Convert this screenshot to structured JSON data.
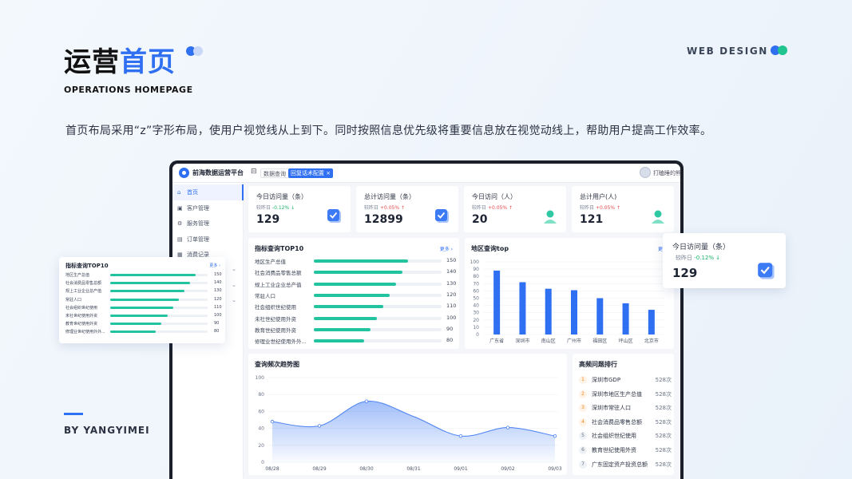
{
  "header": {
    "title_part1": "运营",
    "title_part2": "首页",
    "subtitle": "OPERATIONS HOMEPAGE",
    "web_design": "WEB DESIGN",
    "description": "首页布局采用“z”字形布局，使用户视觉线从上到下。同时按照信息优先级将重要信息放在视觉动线上，帮助用户提高工作效率。",
    "byline": "BY YANGYIMEI"
  },
  "colors": {
    "accent": "#2f6ff2",
    "bar": "#22c4a0",
    "up": "#e84b4b",
    "down": "#18b26b",
    "green_dot": "#1fc48f"
  },
  "app": {
    "title": "前海数据运营平台",
    "tabs": [
      "数据查询",
      "回复话术配置"
    ],
    "tab_close": "×",
    "user_name": "打瞌睡的熊",
    "sidebar": [
      {
        "label": "首页",
        "icon": "home-icon"
      },
      {
        "label": "客户管理",
        "icon": "customer-icon"
      },
      {
        "label": "服务管理",
        "icon": "service-icon"
      },
      {
        "label": "订单管理",
        "icon": "order-icon"
      },
      {
        "label": "消费记录",
        "icon": "record-icon"
      }
    ],
    "stats": [
      {
        "title": "今日访问量（条）",
        "cmp_label": "较昨日",
        "cmp_value": "-0.12%",
        "trend": "down",
        "value": "129",
        "icon": "checkbox-icon"
      },
      {
        "title": "总计访问量（条）",
        "cmp_label": "较昨日",
        "cmp_value": "+0.05%",
        "trend": "up",
        "value": "12899",
        "icon": "checkbox-icon"
      },
      {
        "title": "今日访问（人）",
        "cmp_label": "较昨日",
        "cmp_value": "+0.05%",
        "trend": "up",
        "value": "20",
        "icon": "user-icon"
      },
      {
        "title": "总计用户(人)",
        "cmp_label": "较昨日",
        "cmp_value": "+0.05%",
        "trend": "up",
        "value": "121",
        "icon": "user-icon"
      }
    ],
    "top10": {
      "title": "指标查询TOP10",
      "more": "更多 ›",
      "max": 150,
      "rows": [
        {
          "label": "地区生产总值",
          "value": 150
        },
        {
          "label": "社会消费品零售总额",
          "value": 140
        },
        {
          "label": "规上工业企业总产值",
          "value": 130
        },
        {
          "label": "常驻人口",
          "value": 120
        },
        {
          "label": "社会组织世纪使用",
          "value": 110
        },
        {
          "label": "未社世纪使用外资",
          "value": 100
        },
        {
          "label": "教育世纪使用外资",
          "value": 90
        },
        {
          "label": "修理业世纪使用外外...",
          "value": 80
        }
      ]
    },
    "region": {
      "title": "地区查询top",
      "more": "更多"
    },
    "trend": {
      "title": "查询频次趋势图"
    },
    "ranking": {
      "title": "高频问题排行",
      "items": [
        {
          "no": "1",
          "label": "深圳市GDP",
          "count": "528次"
        },
        {
          "no": "2",
          "label": "深圳市地区生产总值",
          "count": "528次"
        },
        {
          "no": "3",
          "label": "深圳市常驻人口",
          "count": "528次"
        },
        {
          "no": "4",
          "label": "社会消费品零售总额",
          "count": "528次"
        },
        {
          "no": "5",
          "label": "社会组织世纪使用",
          "count": "528次"
        },
        {
          "no": "6",
          "label": "教育世纪使用外资",
          "count": "528次"
        },
        {
          "no": "7",
          "label": "广东固定资产投资总额",
          "count": "528次"
        }
      ]
    }
  },
  "floating": {
    "left_title": "指标查询TOP10",
    "left_more": "更多 ›",
    "right": {
      "title": "今日访问量（条）",
      "cmp_label": "较昨日",
      "cmp_value": "-0.12%",
      "value": "129"
    }
  },
  "chart_data": [
    {
      "type": "bar",
      "title": "地区查询top",
      "categories": [
        "广东省",
        "深圳市",
        "南山区",
        "广州市",
        "福田区",
        "坪山区",
        "北京市"
      ],
      "values": [
        88,
        72,
        63,
        61,
        50,
        43,
        34
      ],
      "ylim": [
        0,
        100
      ],
      "yticks": [
        0,
        10,
        20,
        30,
        40,
        50,
        60,
        70,
        80,
        90,
        100
      ]
    },
    {
      "type": "area",
      "title": "查询频次趋势图",
      "categories": [
        "08/28",
        "08/29",
        "08/30",
        "08/31",
        "09/01",
        "09/02",
        "09/03"
      ],
      "values": [
        48,
        43,
        72,
        54,
        31,
        41,
        31
      ],
      "ylim": [
        0,
        100
      ],
      "yticks": [
        0,
        20,
        40,
        60,
        80,
        100
      ]
    }
  ]
}
